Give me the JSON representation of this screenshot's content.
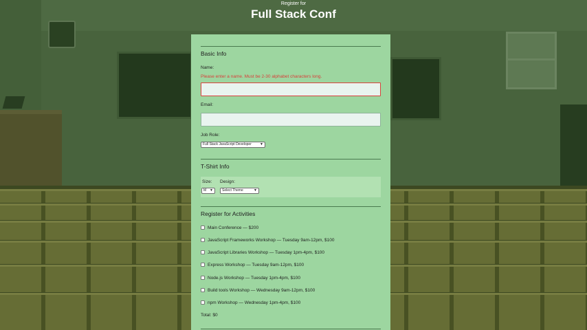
{
  "header": {
    "subtitle": "Register for",
    "title": "Full Stack Conf"
  },
  "basic_info": {
    "title": "Basic Info",
    "name_label": "Name:",
    "name_error": "Please enter a name. Must be 2-30 alphabet characters long.",
    "name_value": "",
    "email_label": "Email:",
    "email_value": "",
    "job_role_label": "Job Role:",
    "job_role_selected": "Full Stack JavaScript Developer"
  },
  "tshirt": {
    "title": "T-Shirt Info",
    "size_label": "Size:",
    "size_selected": "M",
    "design_label": "Design:",
    "design_selected": "Select Theme"
  },
  "activities": {
    "title": "Register for Activities",
    "items": [
      {
        "label": "Main Conference — $200",
        "checked": false
      },
      {
        "label": "JavaScript Frameworks Workshop — Tuesday 9am-12pm, $100",
        "checked": false
      },
      {
        "label": "JavaScript Libraries Workshop — Tuesday 1pm-4pm, $100",
        "checked": false
      },
      {
        "label": "Express Workshop — Tuesday 9am-12pm, $100",
        "checked": false
      },
      {
        "label": "Node.js Workshop — Tuesday 1pm-4pm, $100",
        "checked": false
      },
      {
        "label": "Build tools Workshop — Wednesday 9am-12pm, $100",
        "checked": false
      },
      {
        "label": "npm Workshop — Wednesday 1pm-4pm, $100",
        "checked": false
      }
    ],
    "total": "Total: $0"
  },
  "colors": {
    "panel_bg": "#9dd6a0",
    "error": "#d8403a",
    "overlay_tint": "#3f5a33"
  }
}
